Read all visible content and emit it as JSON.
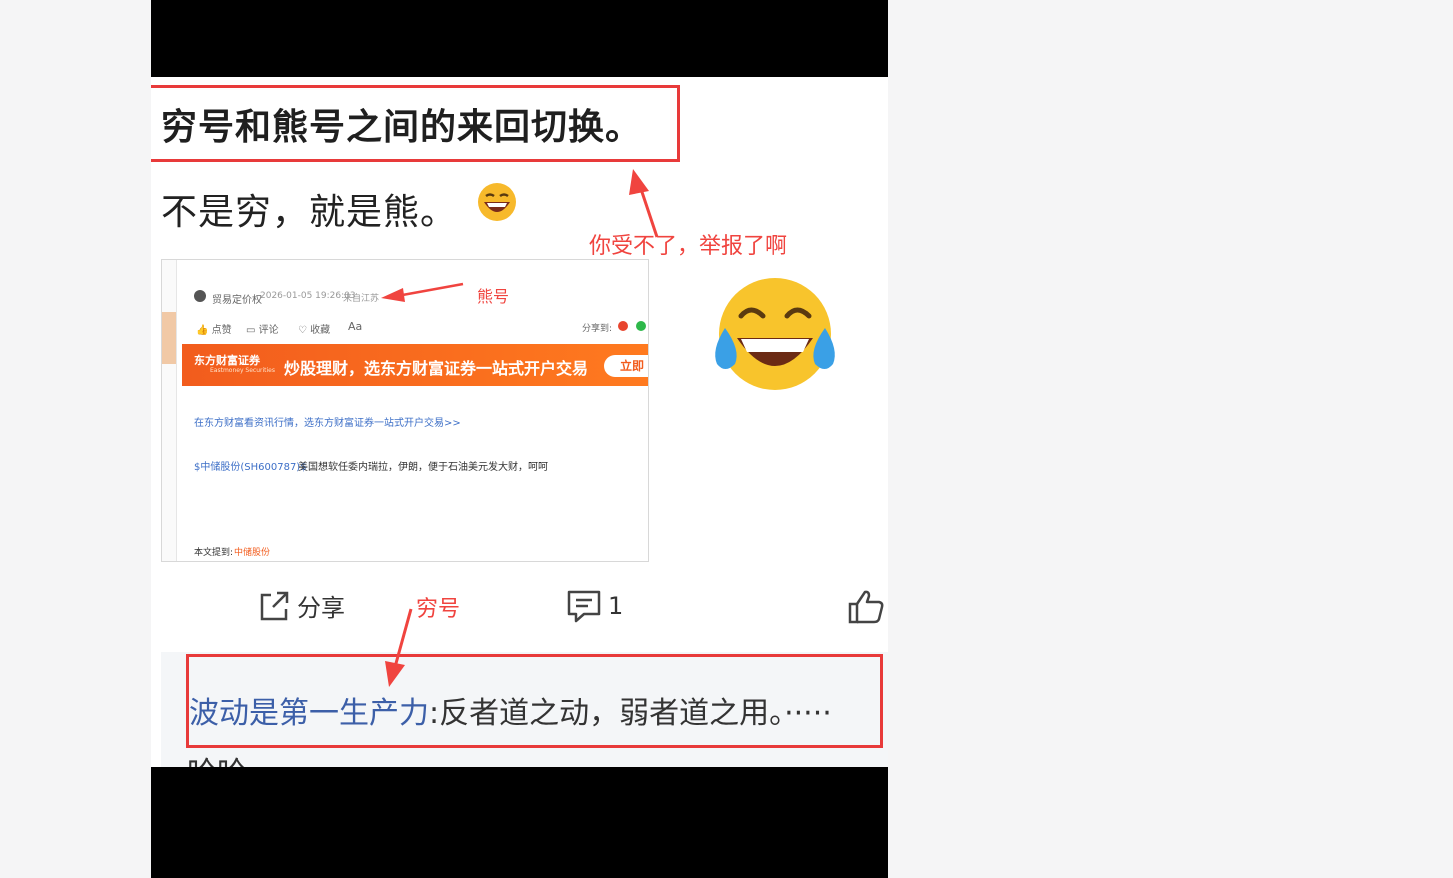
{
  "post": {
    "title": "穷号和熊号之间的来回切换。",
    "body": "不是穷，就是熊。"
  },
  "annotations": {
    "top_note": "你受不了，举报了啊",
    "bear_label": "熊号",
    "poor_label": "穷号"
  },
  "embedded": {
    "author": "贸易定价权",
    "datetime": "2026-01-05 19:26:03",
    "location": "来自江苏",
    "actions": [
      "点赞",
      "评论",
      "收藏",
      "Aa"
    ],
    "share_label": "分享到:",
    "banner_logo": "东方财富证券",
    "banner_logo_sub": "Eastmoney Securities",
    "banner_slogan": "炒股理财，选东方财富证券一站式开户交易",
    "banner_button": "立即",
    "promo_link": "在东方财富看资讯行情，选东方财富证券一站式开户交易>>",
    "stock_tag": "$中储股份(SH600787)$",
    "stock_text": "美国想软任委内瑞拉，伊朗，便于石油美元发大财，呵呵",
    "mention_label": "本文提到:",
    "mention_stock": "中储股份"
  },
  "actions": {
    "share": "分享",
    "comments_count": "1"
  },
  "comment": {
    "user": "波动是第一生产力",
    "text": ":反者道之动，弱者道之用。·····",
    "second_line": "哈哈"
  },
  "colors": {
    "annotation_red": "#e83a3a",
    "link_blue": "#3c5fa8",
    "banner_orange": "#f25c1d"
  }
}
